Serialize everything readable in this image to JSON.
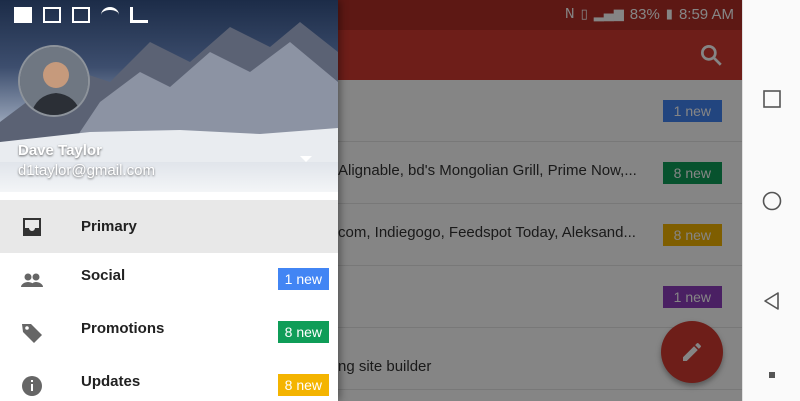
{
  "status_bar": {
    "battery": "83%",
    "time": "8:59 AM"
  },
  "inbox_rows": [
    {
      "snippet": "",
      "badge": "1 new",
      "badge_color": "#4285f4"
    },
    {
      "snippet": "Alignable, bd's Mongolian Grill, Prime Now,...",
      "badge": "8 new",
      "badge_color": "#0f9d58"
    },
    {
      "snippet": "com, Indiegogo, Feedspot Today, Aleksand...",
      "badge": "8 new",
      "badge_color": "#f4b400"
    },
    {
      "snippet": "",
      "badge": "1 new",
      "badge_color": "#8e3fbf"
    },
    {
      "snippet": "ng site builder",
      "badge": "",
      "badge_color": ""
    }
  ],
  "drawer": {
    "account": {
      "name": "Dave Taylor",
      "email": "d1taylor@gmail.com"
    },
    "items": [
      {
        "label": "Primary",
        "icon": "inbox-icon",
        "badge": "",
        "badge_color": ""
      },
      {
        "label": "Social",
        "icon": "people-icon",
        "badge": "1 new",
        "badge_color": "#4285f4"
      },
      {
        "label": "Promotions",
        "icon": "tag-icon",
        "badge": "8 new",
        "badge_color": "#0f9d58"
      },
      {
        "label": "Updates",
        "icon": "info-icon",
        "badge": "8 new",
        "badge_color": "#f4b400"
      }
    ]
  },
  "nav": {
    "icons": [
      "recents-icon",
      "home-icon",
      "back-icon",
      "menu-dot-icon"
    ]
  }
}
